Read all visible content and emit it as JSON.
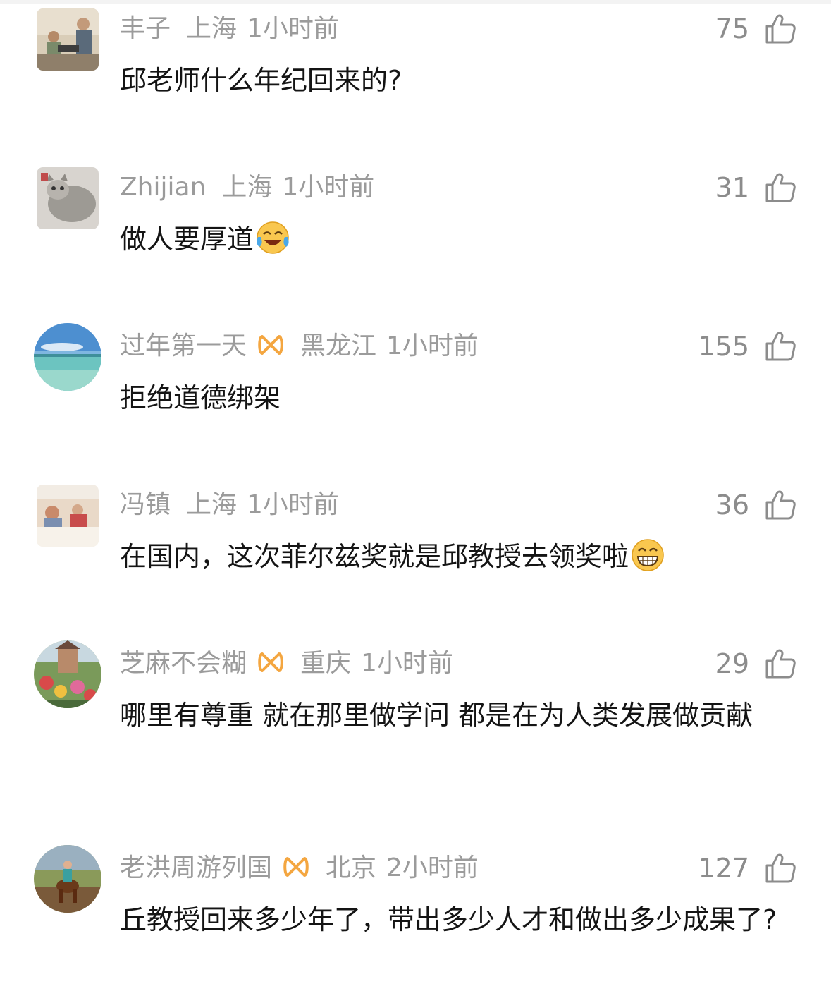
{
  "comments": [
    {
      "user": "丰子",
      "vip": false,
      "location": "上海",
      "time": "1小时前",
      "likes": "75",
      "text": "邱老师什么年纪回来的?",
      "emoji": ""
    },
    {
      "user": "Zhijian",
      "vip": false,
      "location": "上海",
      "time": "1小时前",
      "likes": "31",
      "text": "做人要厚道",
      "emoji": "laughing-crying-emoji"
    },
    {
      "user": "过年第一天",
      "vip": true,
      "location": "黑龙江",
      "time": "1小时前",
      "likes": "155",
      "text": "拒绝道德绑架",
      "emoji": ""
    },
    {
      "user": "冯镇",
      "vip": false,
      "location": "上海",
      "time": "1小时前",
      "likes": "36",
      "text": "在国内，这次菲尔兹奖就是邱教授去领奖啦",
      "emoji": "grinning-emoji"
    },
    {
      "user": "芝麻不会糊",
      "vip": true,
      "location": "重庆",
      "time": "1小时前",
      "likes": "29",
      "text": "哪里有尊重 就在那里做学问 都是在为人类发展做贡献",
      "emoji": ""
    },
    {
      "user": "老洪周游列国",
      "vip": true,
      "location": "北京",
      "time": "2小时前",
      "likes": "127",
      "text": "丘教授回来多少年了，带出多少人才和做出多少成果了?",
      "emoji": ""
    }
  ],
  "colors": {
    "meta_text": "#9b9b9b",
    "like_count": "#8c8c8c",
    "body_text": "#141414",
    "vip_badge": "#f4a640"
  },
  "icons": {
    "like": "thumbs-up-icon",
    "vip": "vip-badge-icon"
  }
}
